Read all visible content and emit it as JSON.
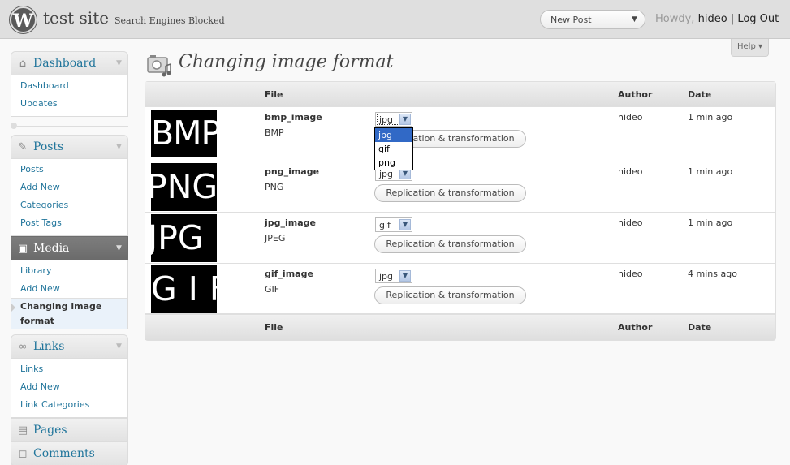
{
  "header": {
    "logo": "W",
    "site_title": "test site",
    "privacy_notice": "Search Engines Blocked",
    "favorite_action": "New Post",
    "favorite_toggle": "▼",
    "howdy": "Howdy,",
    "username": "hideo",
    "separator": "|",
    "logout": "Log Out"
  },
  "help": {
    "label": "Help ▾"
  },
  "menu": {
    "dashboard": {
      "label": "Dashboard",
      "items": [
        "Dashboard",
        "Updates"
      ]
    },
    "posts": {
      "label": "Posts",
      "items": [
        "Posts",
        "Add New",
        "Categories",
        "Post Tags"
      ]
    },
    "media": {
      "label": "Media",
      "items": [
        "Library",
        "Add New"
      ],
      "current_item": "Changing image format"
    },
    "links": {
      "label": "Links",
      "items": [
        "Links",
        "Add New",
        "Link Categories"
      ]
    },
    "pages": {
      "label": "Pages"
    },
    "comments": {
      "label": "Comments"
    },
    "toggle": "▼",
    "icons": {
      "dashboard": "house-icon",
      "posts": "pin-icon",
      "media": "camera-icon",
      "links": "chain-icon",
      "pages": "page-icon",
      "comments": "speech-bubble-icon"
    }
  },
  "page": {
    "title": "Changing image format"
  },
  "table": {
    "headers": {
      "file": "File",
      "author": "Author",
      "date": "Date"
    },
    "format_options": [
      "jpg",
      "gif",
      "png"
    ],
    "rows": [
      {
        "thumb_text": "BMP",
        "name": "bmp_image",
        "type": "BMP",
        "format": "jpg",
        "button": "Replication & transformation",
        "author": "hideo",
        "date": "1 min ago"
      },
      {
        "thumb_text": "PNG",
        "name": "png_image",
        "type": "PNG",
        "format": "jpg",
        "button": "Replication & transformation",
        "author": "hideo",
        "date": "1 min ago"
      },
      {
        "thumb_text": "JPG",
        "name": "jpg_image",
        "type": "JPEG",
        "format": "gif",
        "button": "Replication & transformation",
        "author": "hideo",
        "date": "1 min ago"
      },
      {
        "thumb_text": "GIF",
        "name": "gif_image",
        "type": "GIF",
        "format": "jpg",
        "button": "Replication & transformation",
        "author": "hideo",
        "date": "4 mins ago"
      }
    ]
  },
  "open_dropdown": {
    "options": [
      "jpg",
      "gif",
      "png"
    ],
    "highlighted": "jpg"
  },
  "colors": {
    "link": "#21759b",
    "highlight": "#3169c6",
    "header_bg": "#dfdfdf"
  }
}
